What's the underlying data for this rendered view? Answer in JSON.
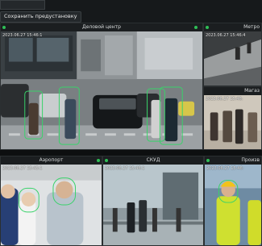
{
  "toolbar": {
    "layout_selector": "",
    "save_preset_label": "Сохранить предустановку"
  },
  "cameras": {
    "main": {
      "title": "Деловой центр",
      "timestamp": "2023.06.27 15:46:1",
      "status_color": "#2fbf56"
    },
    "right_top": {
      "title": "Метро",
      "timestamp": "2023.06.27 15:46:4"
    },
    "right_mid": {
      "title": "Магаз",
      "timestamp": "2023.06.27 15:46:"
    },
    "bottom_left": {
      "title": "Аэропорт",
      "timestamp": "2023.06.27 15:45:1"
    },
    "bottom_mid": {
      "title": "СКУД",
      "timestamp": "2023.06.27 15:46:1"
    },
    "bottom_right": {
      "title": "Произв",
      "timestamp": "2023.06.27 15:46:"
    }
  },
  "colors": {
    "detection_box": "#39d26a",
    "status_live": "#2fbf56"
  }
}
